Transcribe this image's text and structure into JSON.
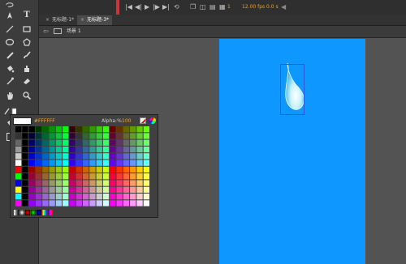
{
  "tabs": [
    {
      "label": "无标题-1*",
      "active": false
    },
    {
      "label": "无标题-3*",
      "active": true
    }
  ],
  "timeline": {
    "frame": "1",
    "fps": "12.00 fps",
    "time": "0.0 s"
  },
  "editbar": {
    "scene_label": "场景 1"
  },
  "swatches": {
    "hex_value": "#FFFFFF",
    "alpha_label": "Alpha:%",
    "alpha_value": "100"
  },
  "colors": {
    "stage": "#0d97ff",
    "selection": "#2b57d8",
    "accent": "#f2a533"
  },
  "icons": [
    "selection-tool-icon",
    "subselection-tool-icon",
    "free-transform-tool-icon",
    "lasso-tool-icon",
    "pen-tool-icon",
    "text-tool-icon",
    "line-tool-icon",
    "rectangle-tool-icon",
    "oval-tool-icon",
    "polystar-tool-icon",
    "pencil-tool-icon",
    "brush-tool-icon",
    "paint-bucket-icon",
    "ink-bottle-icon",
    "eyedropper-icon",
    "eraser-icon",
    "hand-tool-icon",
    "zoom-tool-icon",
    "stroke-color-icon",
    "fill-color-icon"
  ]
}
